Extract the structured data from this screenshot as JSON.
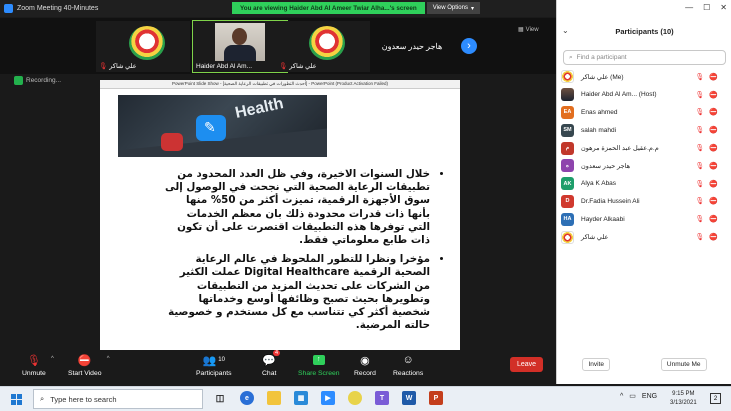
{
  "window": {
    "title": "Zoom Meeting 40-Minutes",
    "viewing_banner": "You are viewing Haider Abd Al Ameer Twiar Alha...'s screen",
    "view_options": "View Options"
  },
  "thumbnails": [
    {
      "name": "علي شاكر",
      "type": "logo"
    },
    {
      "name": "Haider Abd Al Am...",
      "type": "photo",
      "active": true
    },
    {
      "name": "علي شاكر",
      "type": "logo"
    }
  ],
  "namecard": "هاجر حيدر سعدون",
  "view_button": "View",
  "recording_label": "Recording...",
  "slide": {
    "window_title": "PowerPoint Slide Show - [أحدث التطورات في تطبيقات الرعاية الصحية] - PowerPoint (Product Activation Failed)",
    "image_text": "Health",
    "bullets": [
      "خلال السنوات الاخيرة، وفي ظل العدد المحدود من تطبيقات الرعاية الصحية التي نجحت في الوصول إلى سوق الأجهزة الرقمية، تميزت أكثر من 50% منها بأنها ذات قدرات محدودة ذلك بان معظم الخدمات التي توفرها هذه التطبيقات اقتصرت على أن تكون ذات طابع معلوماتي فقط.",
      "مؤخرا ونظرا للتطور الملحوظ في عالم الرعاية الصحية الرقمية Digital Healthcare عملت الكثير من الشركات على تحديث المزيد من التطبيقات وتطويرها بحيث تصبح وظائفها أوسع وخدماتها شخصية أكثر كي تتناسب مع كل مستخدم و خصوصية حالته المرضية."
    ]
  },
  "toolbar": {
    "unmute": "Unmute",
    "start_video": "Start Video",
    "participants": "Participants",
    "participants_count": "10",
    "chat": "Chat",
    "chat_badge": "4",
    "share_screen": "Share Screen",
    "record": "Record",
    "reactions": "Reactions",
    "leave": "Leave"
  },
  "panel": {
    "title": "Participants (10)",
    "search_placeholder": "Find a participant",
    "participants": [
      {
        "name": "علي شاكر (Me)",
        "avatar": "logo",
        "initials": "",
        "color": "#ffffff"
      },
      {
        "name": "Haider Abd Al Am... (Host)",
        "avatar": "photo",
        "initials": "",
        "color": "#555555"
      },
      {
        "name": "Enas ahmed",
        "avatar": "initials",
        "initials": "EA",
        "color": "#e26e1f"
      },
      {
        "name": "salah mahdi",
        "avatar": "initials",
        "initials": "SM",
        "color": "#37474f"
      },
      {
        "name": "م.م.عقيل عبد الحمزة مرهون",
        "avatar": "initials",
        "initials": "م",
        "color": "#c1382b"
      },
      {
        "name": "هاجر حيدر سعدون",
        "avatar": "initials",
        "initials": "ه",
        "color": "#8e44ad"
      },
      {
        "name": "Alya K Abas",
        "avatar": "initials",
        "initials": "AK",
        "color": "#1e9e6a"
      },
      {
        "name": "Dr.Fadia Hussein Ali",
        "avatar": "initials",
        "initials": "D",
        "color": "#d0392e"
      },
      {
        "name": "Hayder Alkaabi",
        "avatar": "initials",
        "initials": "HA",
        "color": "#2d6fb5"
      },
      {
        "name": "علي شاكر",
        "avatar": "logo",
        "initials": "",
        "color": "#ffffff"
      }
    ],
    "invite": "Invite",
    "unmute_me": "Unmute Me"
  },
  "taskbar": {
    "search_placeholder": "Type here to search",
    "lang": "ENG",
    "time": "9:15 PM",
    "date": "3/13/2021",
    "notification_count": "2"
  },
  "colors": {
    "zoom_blue": "#2d8cff",
    "leave_red": "#d22f27",
    "banner_green": "#2fd05b"
  }
}
